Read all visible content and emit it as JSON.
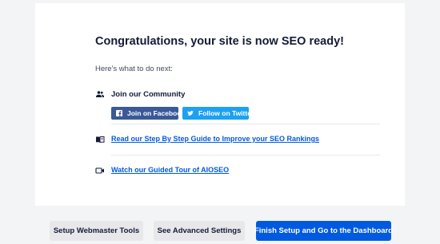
{
  "heading": "Congratulations, your site is now SEO ready!",
  "subheading": "Here's what to do next:",
  "community": {
    "icon": "users-icon",
    "title": "Join our Community",
    "facebook_label": "Join on Facebook",
    "twitter_label": "Follow on Twitter",
    "facebook_color": "#3b5998",
    "twitter_color": "#1da1f2"
  },
  "guide": {
    "icon": "book-icon",
    "link_text": "Read our Step By Step Guide to Improve your SEO Rankings"
  },
  "tour": {
    "icon": "video-camera-icon",
    "link_text": "Watch our Guided Tour of AIOSEO"
  },
  "footer": {
    "webmaster_label": "Setup Webmaster Tools",
    "advanced_label": "See Advanced Settings",
    "finish_label": "Finish Setup and Go to the Dashboard"
  },
  "colors": {
    "accent": "#005ae0",
    "text": "#141b38",
    "background": "#f3f4f5"
  }
}
